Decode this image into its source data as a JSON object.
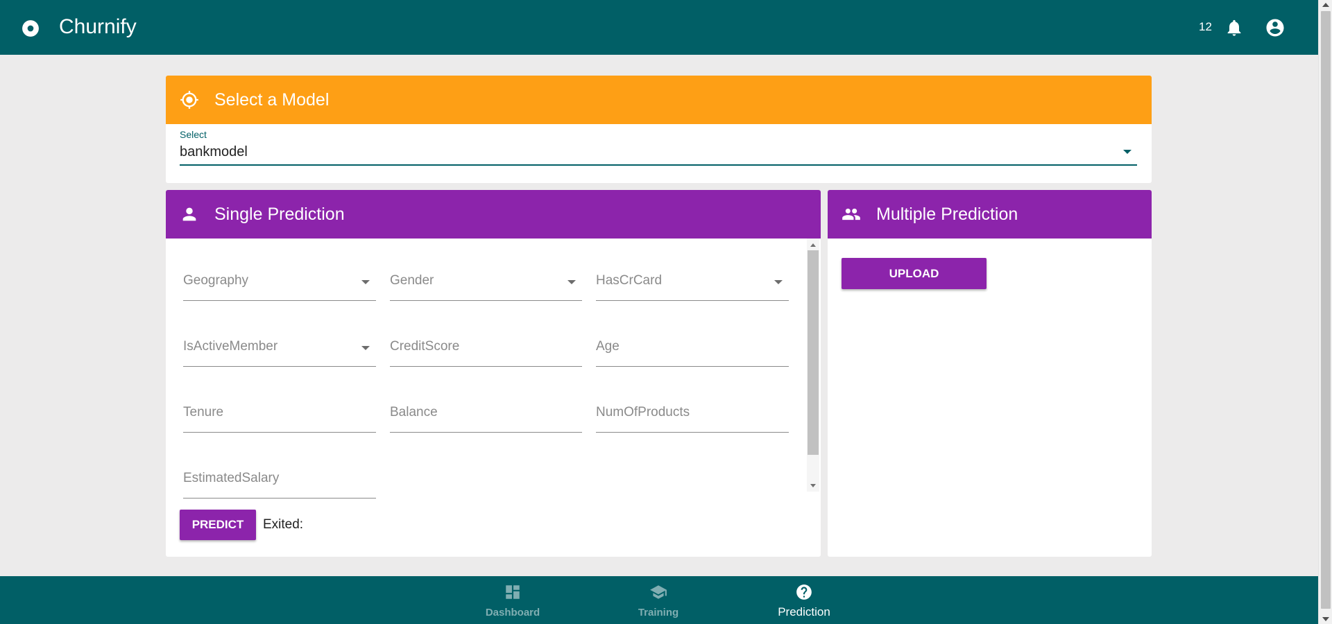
{
  "app": {
    "title": "Churnify",
    "notification_count": "12",
    "colors": {
      "appbar": "#015f66",
      "model_header": "#fe9f15",
      "prediction_header": "#8c24ab"
    }
  },
  "model_select": {
    "header": "Select a Model",
    "label": "Select",
    "value": "bankmodel",
    "icon": "crosshair-icon"
  },
  "single_prediction": {
    "header": "Single Prediction",
    "icon": "person-icon",
    "fields": [
      {
        "label": "Geography",
        "type": "select"
      },
      {
        "label": "Gender",
        "type": "select"
      },
      {
        "label": "HasCrCard",
        "type": "select"
      },
      {
        "label": "IsActiveMember",
        "type": "select"
      },
      {
        "label": "CreditScore",
        "type": "text"
      },
      {
        "label": "Age",
        "type": "text"
      },
      {
        "label": "Tenure",
        "type": "text"
      },
      {
        "label": "Balance",
        "type": "text"
      },
      {
        "label": "NumOfProducts",
        "type": "text"
      },
      {
        "label": "EstimatedSalary",
        "type": "text"
      }
    ],
    "predict_label": "Predict",
    "result_label": "Exited:"
  },
  "multiple_prediction": {
    "header": "Multiple Prediction",
    "icon": "people-icon",
    "upload_label": "Upload"
  },
  "bottom_nav": {
    "items": [
      {
        "label": "Dashboard",
        "icon": "dashboard-icon",
        "active": false
      },
      {
        "label": "Training",
        "icon": "school-icon",
        "active": false
      },
      {
        "label": "Prediction",
        "icon": "help-circle-icon",
        "active": true
      }
    ]
  }
}
